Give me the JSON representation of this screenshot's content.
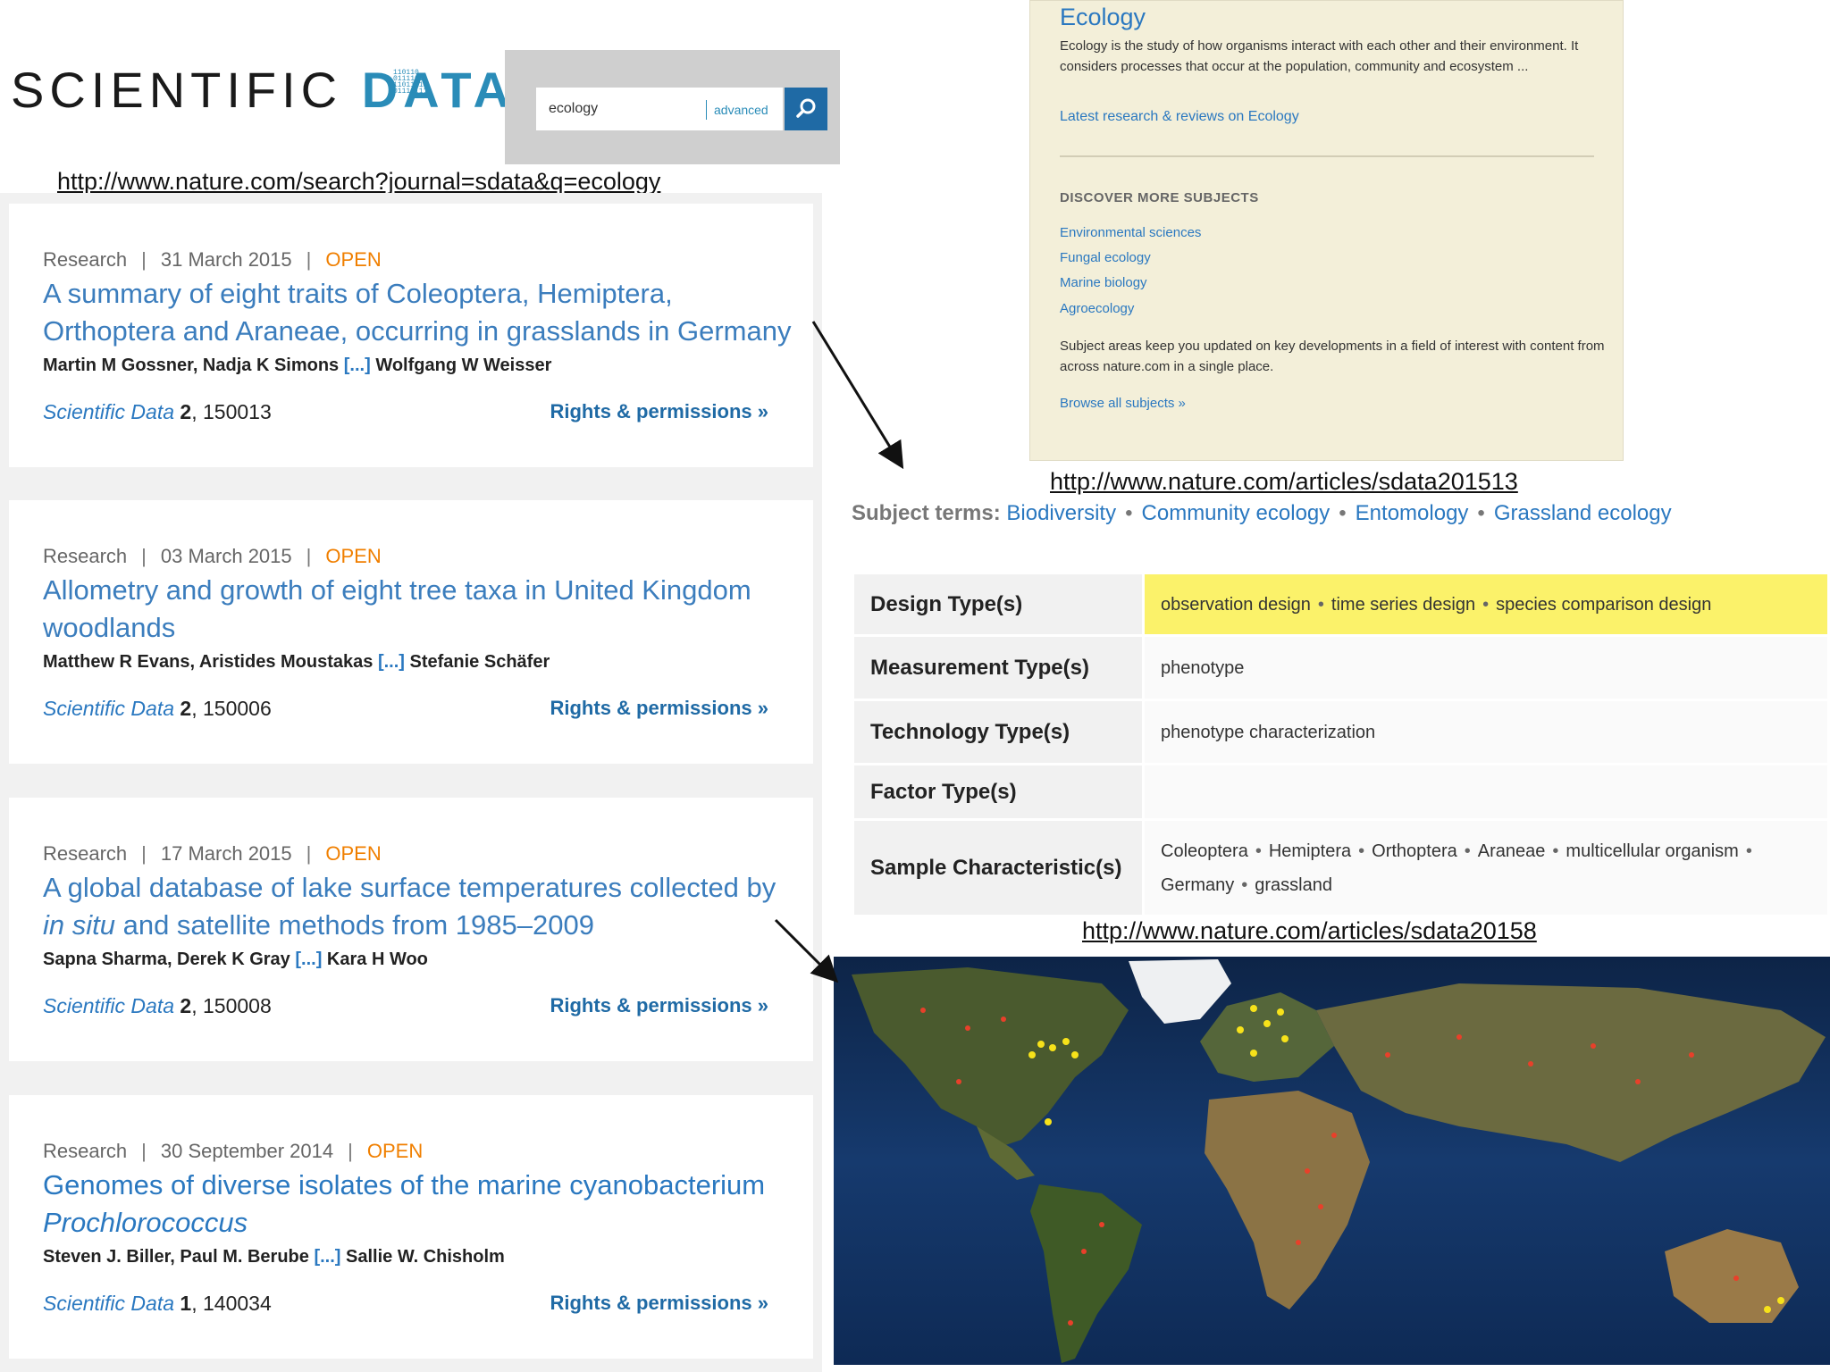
{
  "logo": {
    "text_plain": "SCIENTIFIC ",
    "text_accent": "DATA",
    "bits": "110110\n0111101\n11011110\n01110111"
  },
  "search": {
    "value": "ecology",
    "advanced_label": "advanced"
  },
  "urls": {
    "search": "http://www.nature.com/search?journal=sdata&q=ecology",
    "article1": "http://www.nature.com/articles/sdata201513",
    "article2": "http://www.nature.com/articles/sdata20158"
  },
  "results": [
    {
      "type": "Research",
      "date": "31 March 2015",
      "access": "OPEN",
      "title": "A summary of eight traits of Coleoptera, Hemiptera, Orthoptera and Araneae, occurring in grasslands in Germany",
      "author_first": "Martin M Gossner, Nadja K Simons",
      "ellipsis": "[...]",
      "author_last": "Wolfgang W Weisser",
      "journal": "Scientific Data",
      "volume": "2",
      "article_no": ", 150013",
      "rights": "Rights & permissions  »"
    },
    {
      "type": "Research",
      "date": "03 March 2015",
      "access": "OPEN",
      "title": "Allometry and growth of eight tree taxa in United Kingdom woodlands",
      "author_first": "Matthew R Evans, Aristides Moustakas",
      "ellipsis": "[...]",
      "author_last": "Stefanie Schäfer",
      "journal": "Scientific Data",
      "volume": "2",
      "article_no": ", 150006",
      "rights": "Rights & permissions  »"
    },
    {
      "type": "Research",
      "date": "17 March 2015",
      "access": "OPEN",
      "title_pre": "A global database of lake surface temperatures collected by ",
      "title_italic": "in situ",
      "title_post": " and satellite methods from 1985–2009",
      "author_first": "Sapna Sharma, Derek K Gray",
      "ellipsis": "[...]",
      "author_last": "Kara H Woo",
      "journal": "Scientific Data",
      "volume": "2",
      "article_no": ", 150008",
      "rights": "Rights & permissions  »"
    },
    {
      "type": "Research",
      "date": "30 September 2014",
      "access": "OPEN",
      "title_pre": "Genomes of diverse isolates of the marine cyanobacterium ",
      "title_italic": "Prochlorococcus",
      "author_first": "Steven J. Biller, Paul M. Berube",
      "ellipsis": "[...]",
      "author_last": "Sallie W. Chisholm",
      "journal": "Scientific Data",
      "volume": "1",
      "article_no": ", 140034",
      "rights": "Rights & permissions  »"
    }
  ],
  "ecology": {
    "title": "Ecology",
    "description": "Ecology is the study of how organisms interact with each other and their environment. It considers processes that occur at the population, community and ecosystem ...",
    "latest_link": "Latest research & reviews on Ecology",
    "discover_heading": "DISCOVER MORE SUBJECTS",
    "subjects": [
      "Environmental sciences",
      "Fungal ecology",
      "Marine biology",
      "Agroecology"
    ],
    "note": "Subject areas keep you updated on key developments in a field of interest with content from across nature.com in a single place.",
    "browse_link": "Browse all subjects »"
  },
  "subject_terms": {
    "label": "Subject terms:",
    "terms": [
      "Biodiversity",
      "Community ecology",
      "Entomology",
      "Grassland ecology"
    ],
    "dot": "•"
  },
  "metadata_table": {
    "rows": [
      {
        "label": "Design Type(s)",
        "values": [
          "observation design",
          "time series design",
          "species comparison design"
        ]
      },
      {
        "label": "Measurement Type(s)",
        "values": [
          "phenotype"
        ]
      },
      {
        "label": "Technology Type(s)",
        "values": [
          "phenotype characterization"
        ]
      },
      {
        "label": "Factor Type(s)",
        "values": []
      },
      {
        "label": "Sample Characteristic(s)",
        "line1": [
          "Coleoptera",
          "Hemiptera",
          "Orthoptera",
          "Araneae",
          "multicellular organism"
        ],
        "line2": [
          "Germany",
          "grassland"
        ]
      }
    ],
    "dot": "•"
  },
  "colors": {
    "accent": "#2a8cb8",
    "link": "#3b7dbd",
    "open": "#f07f00",
    "highlight": "#fbf26a",
    "search_button": "#1f6aa5"
  },
  "icons": {
    "search_button": "search-icon",
    "arrows": "arrow-icon"
  }
}
